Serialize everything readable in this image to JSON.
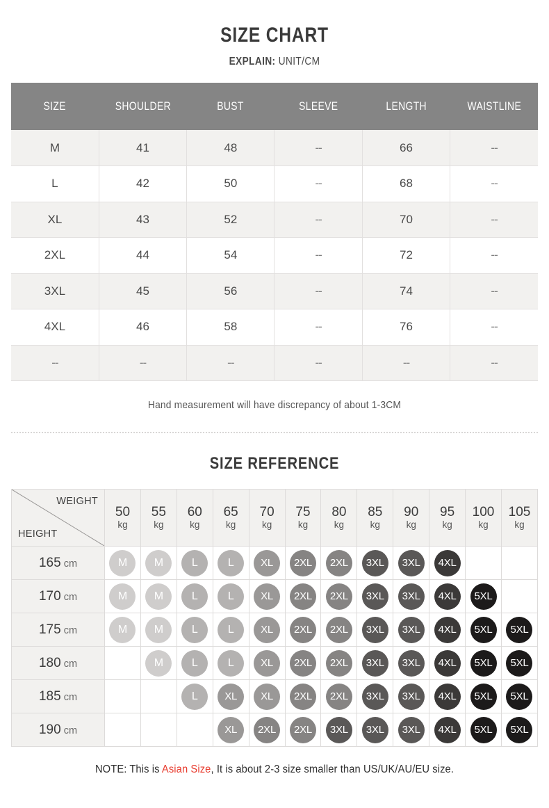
{
  "header": {
    "title": "SIZE CHART",
    "explain_label": "EXPLAIN:",
    "explain_value": "UNIT/CM"
  },
  "size_chart": {
    "columns": [
      "SIZE",
      "SHOULDER",
      "BUST",
      "SLEEVE",
      "LENGTH",
      "WAISTLINE"
    ],
    "rows": [
      [
        "M",
        "41",
        "48",
        "--",
        "66",
        "--"
      ],
      [
        "L",
        "42",
        "50",
        "--",
        "68",
        "--"
      ],
      [
        "XL",
        "43",
        "52",
        "--",
        "70",
        "--"
      ],
      [
        "2XL",
        "44",
        "54",
        "--",
        "72",
        "--"
      ],
      [
        "3XL",
        "45",
        "56",
        "--",
        "74",
        "--"
      ],
      [
        "4XL",
        "46",
        "58",
        "--",
        "76",
        "--"
      ],
      [
        "--",
        "--",
        "--",
        "--",
        "--",
        "--"
      ]
    ],
    "note": "Hand measurement will have discrepancy of about 1-3CM"
  },
  "size_reference": {
    "title": "SIZE REFERENCE",
    "weight_label": "WEIGHT",
    "height_label": "HEIGHT",
    "weight_unit": "kg",
    "height_unit": "cm",
    "weights": [
      "50",
      "55",
      "60",
      "65",
      "70",
      "75",
      "80",
      "85",
      "90",
      "95",
      "100",
      "105"
    ],
    "heights": [
      "165",
      "170",
      "175",
      "180",
      "185",
      "190"
    ],
    "grid": [
      [
        "M",
        "M",
        "L",
        "L",
        "XL",
        "2XL",
        "2XL",
        "3XL",
        "3XL",
        "4XL",
        "",
        ""
      ],
      [
        "M",
        "M",
        "L",
        "L",
        "XL",
        "2XL",
        "2XL",
        "3XL",
        "3XL",
        "4XL",
        "5XL",
        ""
      ],
      [
        "M",
        "M",
        "L",
        "L",
        "XL",
        "2XL",
        "2XL",
        "3XL",
        "3XL",
        "4XL",
        "5XL",
        "5XL"
      ],
      [
        "",
        "M",
        "L",
        "L",
        "XL",
        "2XL",
        "2XL",
        "3XL",
        "3XL",
        "4XL",
        "5XL",
        "5XL"
      ],
      [
        "",
        "",
        "L",
        "XL",
        "XL",
        "2XL",
        "2XL",
        "3XL",
        "3XL",
        "4XL",
        "5XL",
        "5XL"
      ],
      [
        "",
        "",
        "",
        "XL",
        "2XL",
        "2XL",
        "3XL",
        "3XL",
        "3XL",
        "4XL",
        "5XL",
        "5XL"
      ]
    ]
  },
  "bubble_colors": {
    "M": "#cfcdcc",
    "L": "#b4b2b1",
    "XL": "#9a9897",
    "2XL": "#868483",
    "3XL": "#5a5857",
    "4XL": "#3b3938",
    "5XL": "#1c1a1a"
  },
  "footer": {
    "note_prefix": "NOTE: This is ",
    "note_highlight": "Asian Size",
    "note_suffix": ", It is about 2-3 size smaller than US/UK/AU/EU size.",
    "highlight_color": "#e83b2e"
  }
}
